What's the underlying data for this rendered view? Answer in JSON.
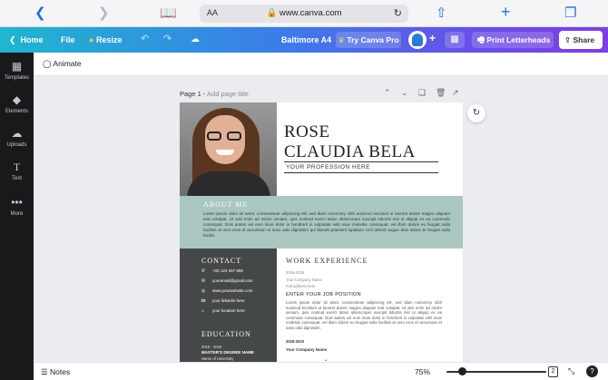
{
  "browser": {
    "url": "www.canva.com",
    "aa_label": "AA"
  },
  "header": {
    "home": "Home",
    "file": "File",
    "resize": "Resize",
    "doc_title": "Baltimore A4",
    "try_pro": "Try Canva Pro",
    "print": "Print Letterheads",
    "share": "Share"
  },
  "sidebar": {
    "items": [
      {
        "label": "Templates"
      },
      {
        "label": "Elements"
      },
      {
        "label": "Uploads"
      },
      {
        "label": "Text"
      },
      {
        "label": "More"
      }
    ]
  },
  "toolbar": {
    "animate": "Animate"
  },
  "canvas": {
    "page_label": "Page 1",
    "page_title_placeholder": "Add page title"
  },
  "resume": {
    "first_name": "ROSE",
    "last_name": "CLAUDIA BELA",
    "profession": "YOUR PROFESSION HERE",
    "about_title": "ABOUT ME",
    "about_text": "Lorem ipsum dolor sit amet, consectetuer adipiscing elit, sed diam nonummy nibh euismod tincidunt ut laoreet dolore magna aliquam erat volutpat. Ut wisi enim ad minim veniam, quis nostrud exerci tation ullamcorper suscipit lobortis nisl ut aliquip ex ea commodo consequat. Duis autem vel eum iriure dolor in hendrerit in vulputate velit esse molestie consequat, vel illum dolore eu feugiat nulla facilisis at vero eros et accumsan et iusto odio dignissim qui blandit praesent luptatum zzril delenit augue duis dolore te feugait nulla facilisi.",
    "contact_title": "CONTACT",
    "contact": {
      "phone": "+00 123 457 895",
      "email": "youremail@gmail.com",
      "website": "www.yourwebsite.com",
      "linkedin": "your linkedin here",
      "location": "your location here"
    },
    "education_title": "EDUCATION",
    "education": {
      "dates": "2015 - 2016",
      "degree": "MASTER'S DEGREE NAME",
      "school": "Name of University"
    },
    "work_title": "WORK EXPERIENCE",
    "work": {
      "dates": "2016-2018",
      "company": "Your Company Name",
      "address": "Full address here",
      "job_title": "ENTER YOUR JOB POSITION",
      "description": "Lorem ipsum dolor sit amet, consectetuer adipiscing elit, sed diam nonummy nibh euismod tincidunt ut laoreet dolore magna aliquam erat volutpat. Ut wisi enim ad minim veniam, quis nostrud exerci tation ullamcorper suscipit lobortis nisl ut aliquip ex ea commodo consequat. Duis autem vel eum iriure dolor in hendrerit in vulputate velit esse molestie consequat, vel illum dolore eu feugiat nulla facilisis at vero eros et accumsan et iusto odio dignissim.",
      "dates2": "2018-2020",
      "company2": "Your Company Name"
    }
  },
  "footer": {
    "notes": "Notes",
    "zoom": "75%",
    "page_count": "2"
  },
  "colors": {
    "about_bg": "#a9c7c0",
    "dark_col": "#454849",
    "sidebar_bg": "#18191b"
  }
}
